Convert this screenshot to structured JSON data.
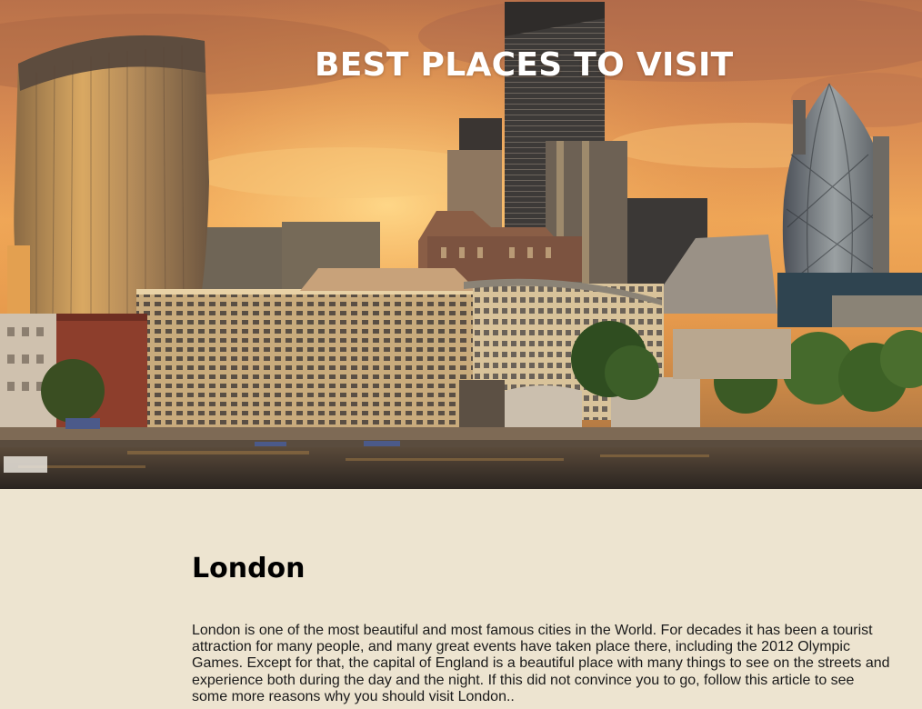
{
  "hero": {
    "title": "BEST PLACES TO VISIT",
    "image_alt": "London skyline at sunset over the River Thames"
  },
  "article": {
    "title": "London",
    "body": "London is one of the most beautiful and most famous cities in the World. For decades it has been a tourist attraction for many people, and many great events have taken place there, including the 2012 Olympic Games. Except for that, the capital of England is a beautiful place with many things to see on the streets and experience both during the day and the night. If this did not convince you to go, follow this article to see some more reasons why you should visit London.."
  },
  "colors": {
    "page_background": "#ede4d0",
    "hero_title": "#ffffff",
    "sky_top": "#c9794b",
    "sky_glow": "#f6b860",
    "water": "#3a3029"
  }
}
